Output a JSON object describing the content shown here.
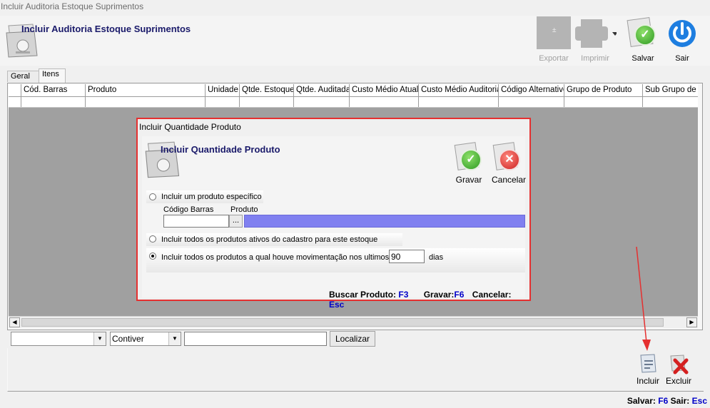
{
  "window": {
    "title": "Incluir Auditoria Estoque Suprimentos"
  },
  "header": {
    "title": "Incluir Auditoria Estoque Suprimentos"
  },
  "toolbar": {
    "export_label": "Exportar",
    "print_label": "Imprimir",
    "save_label": "Salvar",
    "exit_label": "Sair",
    "export_icon": "export-icon",
    "print_icon": "printer-icon",
    "save_icon": "save-check-icon",
    "exit_icon": "power-icon"
  },
  "tabs": [
    {
      "label": "Geral"
    },
    {
      "label": "Itens"
    }
  ],
  "grid": {
    "columns": [
      "Cód. Barras",
      "Produto",
      "Unidade",
      "Qtde. Estoque",
      "Qtde. Auditada",
      "Custo Médio Atual",
      "Custo Médio Auditoria",
      "Código Alternativo",
      "Grupo de Produto",
      "Sub Grupo de P"
    ]
  },
  "filter": {
    "field_value": "",
    "operator_value": "Contiver",
    "search_value": "",
    "search_button": "Localizar"
  },
  "actions": {
    "add_label": "Incluir",
    "delete_label": "Excluir"
  },
  "status_bar": {
    "save_text": "Salvar:",
    "save_key": "F6",
    "exit_text": "Sair:",
    "exit_key": "Esc"
  },
  "dialog": {
    "window_title": "Incluir Quantidade Produto",
    "header_title": "Incluir Quantidade Produto",
    "confirm_label": "Gravar",
    "cancel_label": "Cancelar",
    "option_specific": "Incluir um produto específico",
    "barcode_label": "Código Barras",
    "product_label": "Produto",
    "barcode_value": "",
    "browse_label": "...",
    "option_all_active": "Incluir todos os produtos ativos do cadastro para este estoque",
    "option_movement": "Incluir todos os produtos a qual houve movimentação nos ultimos",
    "days_value": "90",
    "days_label": "dias",
    "selected_option": "movement",
    "hint_search": "Buscar Produto:",
    "hint_search_key": "F3",
    "hint_save": "Gravar:",
    "hint_save_key": "F6",
    "hint_cancel": "Cancelar:",
    "hint_cancel_key": "Esc",
    "product_field_color": "#8080f0"
  },
  "colors": {
    "annotation_arrow": "#e53030",
    "dialog_border": "#e53030",
    "hotkey": "#0000c8",
    "header_title": "#1a1a6a"
  }
}
